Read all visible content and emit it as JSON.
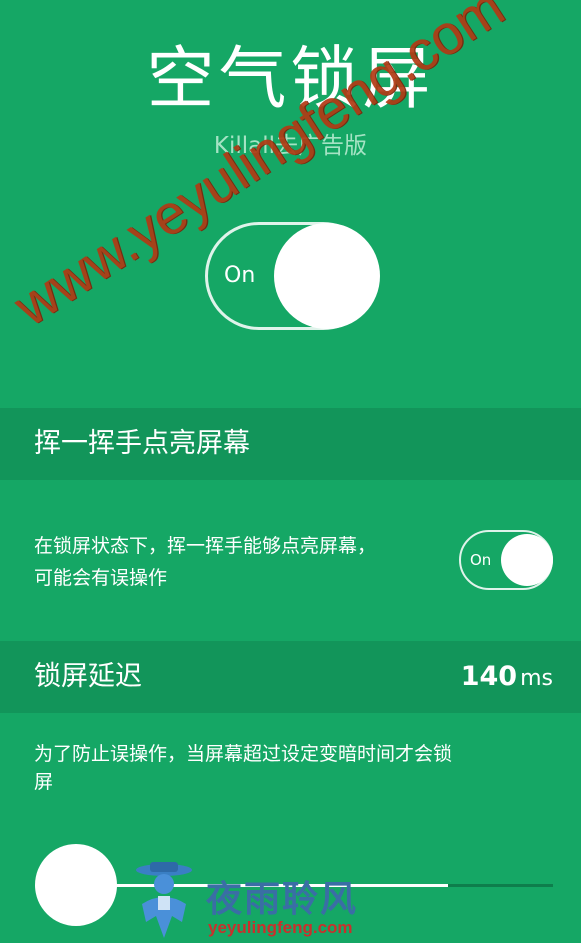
{
  "header": {
    "title": "空气锁屏",
    "subtitle": "Killall去广告版"
  },
  "main_switch": {
    "label": "On",
    "state": "on"
  },
  "wave_section": {
    "title": "挥一挥手点亮屏幕",
    "description_line1": "在锁屏状态下，挥一挥手能够点亮屏幕，",
    "description_line2": "可能会有误操作",
    "toggle_label": "On",
    "toggle_state": "on"
  },
  "delay_section": {
    "title": "锁屏延迟",
    "value": "140",
    "unit": "ms",
    "description_line1": "为了防止误操作，当屏幕超过设定变暗时间才会锁",
    "description_line2": "屏",
    "slider_fill_fraction": 0.78
  },
  "watermarks": {
    "diagonal_text": "www.yeyulingfeng.com",
    "logo_text": "夜雨聆风",
    "logo_url": "yeyulingfeng.com"
  },
  "colors": {
    "background": "#15a765",
    "section_header": "#12955a",
    "watermark_red": "#b23a14",
    "logo_blue": "#3a6ea5"
  },
  "icons": {
    "logo_figure": "person-with-hat-icon"
  }
}
